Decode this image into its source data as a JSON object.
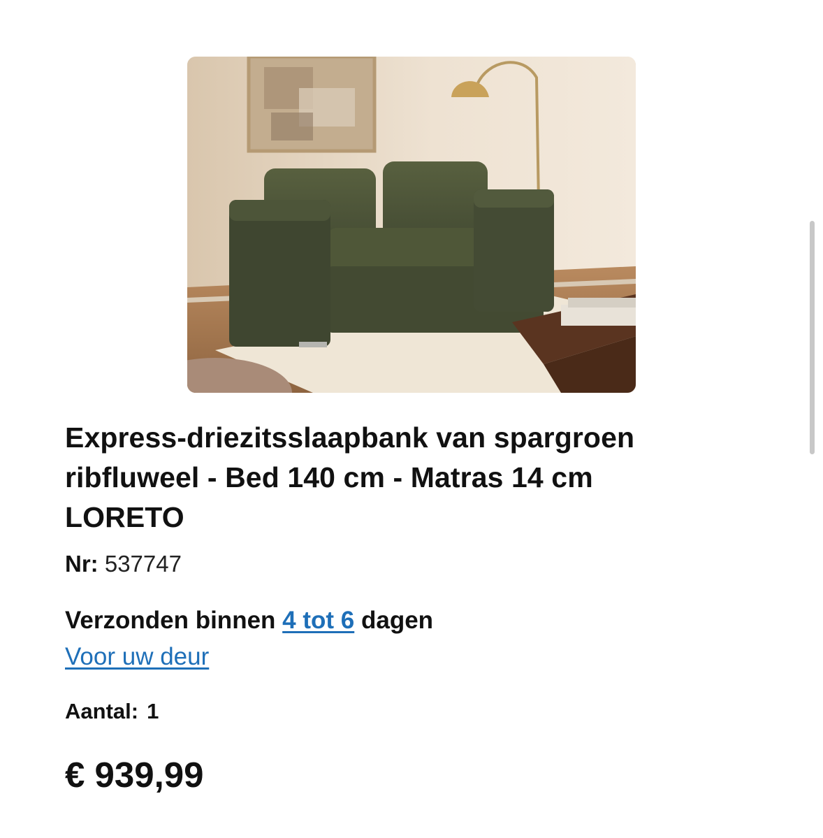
{
  "product": {
    "title_line1": "Express-driezitsslaapbank van spargroen",
    "title_line2": "ribfluweel - Bed 140 cm - Matras 14 cm",
    "title_line3": "LORETO",
    "sku_label": "Nr:",
    "sku_value": "537747",
    "image_icon": "product-photo-sofa"
  },
  "shipping": {
    "prefix": "Verzonden binnen",
    "range": "4 tot 6",
    "suffix": "dagen",
    "delivery_link": "Voor uw deur"
  },
  "quantity": {
    "label": "Aantal:",
    "value": "1"
  },
  "price": {
    "value": "€ 939,99"
  },
  "colors": {
    "link": "#1e6fb8",
    "text": "#111111",
    "sofa": "#4a5238"
  }
}
